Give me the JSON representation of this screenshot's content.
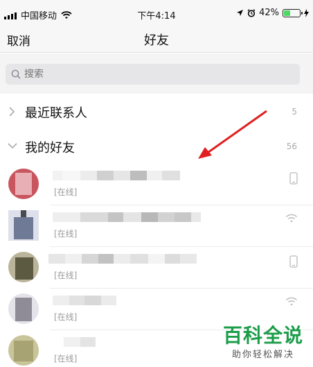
{
  "status_bar": {
    "carrier": "中国移动",
    "time": "下午4:14",
    "battery_percent": "42%",
    "battery_level": 0.42
  },
  "nav": {
    "cancel_label": "取消",
    "title": "好友"
  },
  "search": {
    "placeholder": "搜索"
  },
  "groups": [
    {
      "label": "最近联系人",
      "count": "5",
      "expanded": false
    },
    {
      "label": "我的好友",
      "count": "56",
      "expanded": true
    }
  ],
  "contacts": [
    {
      "status": "[在线]",
      "device": "phone-icon",
      "avatar_color": "#c9555e"
    },
    {
      "status": "[在线]",
      "device": "wifi-icon",
      "avatar_color": "#6f7a96"
    },
    {
      "status": "[在线]",
      "device": "phone-icon",
      "avatar_color": "#5c5a40"
    },
    {
      "status": "[在线]",
      "device": "wifi-icon",
      "avatar_color": "#8f8c97"
    },
    {
      "status": "[在线]",
      "device": "",
      "avatar_color": "#a7a372"
    }
  ],
  "watermark": {
    "title": "百科全说",
    "subtitle": "助你轻松解决"
  },
  "colors": {
    "watermark_green": "#1c9d4a",
    "annotation_arrow": "#e02020",
    "battery_green": "#4cd964"
  }
}
